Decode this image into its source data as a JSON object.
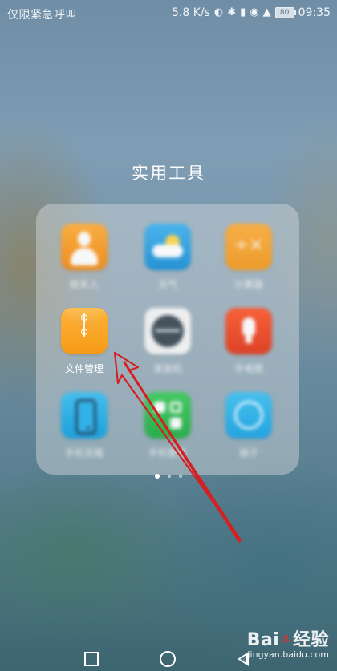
{
  "status_bar": {
    "carrier_text": "仅限紧急呼叫",
    "network_speed": "5.8 K/s",
    "battery_level": "80",
    "time": "09:35",
    "icons": [
      "speed-icon",
      "bluetooth-icon",
      "vibrate-icon",
      "eye-comfort-icon",
      "wifi-icon",
      "battery-icon"
    ]
  },
  "folder": {
    "title": "实用工具",
    "apps": [
      {
        "label": "联系人",
        "icon": "contacts-icon",
        "blurred": true
      },
      {
        "label": "天气",
        "icon": "weather-icon",
        "blurred": true
      },
      {
        "label": "计算器",
        "icon": "calculator-icon",
        "blurred": true
      },
      {
        "label": "文件管理",
        "icon": "file-manager-icon",
        "blurred": false
      },
      {
        "label": "录音机",
        "icon": "recorder-icon",
        "blurred": true
      },
      {
        "label": "手电筒",
        "icon": "flashlight-icon",
        "blurred": true
      },
      {
        "label": "手机克隆",
        "icon": "phone-icon",
        "blurred": true
      },
      {
        "label": "手机管家",
        "icon": "green-app-icon",
        "blurred": true
      },
      {
        "label": "镜子",
        "icon": "mirror-icon",
        "blurred": true
      }
    ],
    "page_indicator": {
      "pages": 3,
      "current": 1
    }
  },
  "nav_bar": {
    "buttons": [
      "recent-apps-icon",
      "home-icon",
      "back-icon"
    ]
  },
  "watermark": {
    "brand": "Bai",
    "brand_suffix": "经验",
    "url": "jingyan.baidu.com"
  },
  "annotation": {
    "type": "arrow",
    "color": "#d42020"
  }
}
